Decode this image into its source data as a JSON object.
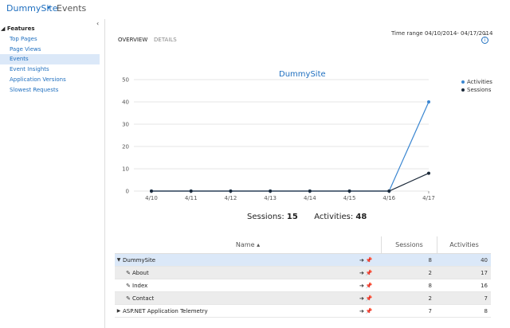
{
  "header": {
    "site": "DummySite",
    "page": "Events"
  },
  "sidebar": {
    "collapse_glyph": "‹",
    "section": "Features",
    "items": [
      {
        "label": "Top Pages"
      },
      {
        "label": "Page Views"
      },
      {
        "label": "Events",
        "active": true
      },
      {
        "label": "Event Insights"
      },
      {
        "label": "Application Versions"
      },
      {
        "label": "Slowest Requests"
      }
    ]
  },
  "tabs": {
    "overview": "OVERVIEW",
    "details": "DETAILS"
  },
  "time_range": {
    "label": "Time range",
    "value": "04/10/2014- 04/17/2014"
  },
  "chart_data": {
    "type": "line",
    "title": "DummySite",
    "categories": [
      "4/10",
      "4/11",
      "4/12",
      "4/13",
      "4/14",
      "4/15",
      "4/16",
      "4/17"
    ],
    "ylim": [
      0,
      50
    ],
    "yticks": [
      0,
      10,
      20,
      30,
      40,
      50
    ],
    "grid": true,
    "legend_position": "top-right",
    "series": [
      {
        "name": "Activities",
        "color": "#3a86d1",
        "values": [
          0,
          0,
          0,
          0,
          0,
          0,
          0,
          40
        ]
      },
      {
        "name": "Sessions",
        "color": "#1c2a3a",
        "values": [
          0,
          0,
          0,
          0,
          0,
          0,
          0,
          8
        ]
      }
    ]
  },
  "stats": {
    "sessions_label": "Sessions:",
    "sessions_value": "15",
    "activities_label": "Activities:",
    "activities_value": "48"
  },
  "table": {
    "headers": {
      "name": "Name",
      "sessions": "Sessions",
      "activities": "Activities"
    },
    "rows": [
      {
        "name": "DummySite",
        "sessions": "8",
        "activities": "40"
      },
      {
        "name": "About",
        "sessions": "2",
        "activities": "17"
      },
      {
        "name": "Index",
        "sessions": "8",
        "activities": "16"
      },
      {
        "name": "Contact",
        "sessions": "2",
        "activities": "7"
      },
      {
        "name": "ASP.NET Application Telemetry",
        "sessions": "7",
        "activities": "8"
      }
    ]
  }
}
